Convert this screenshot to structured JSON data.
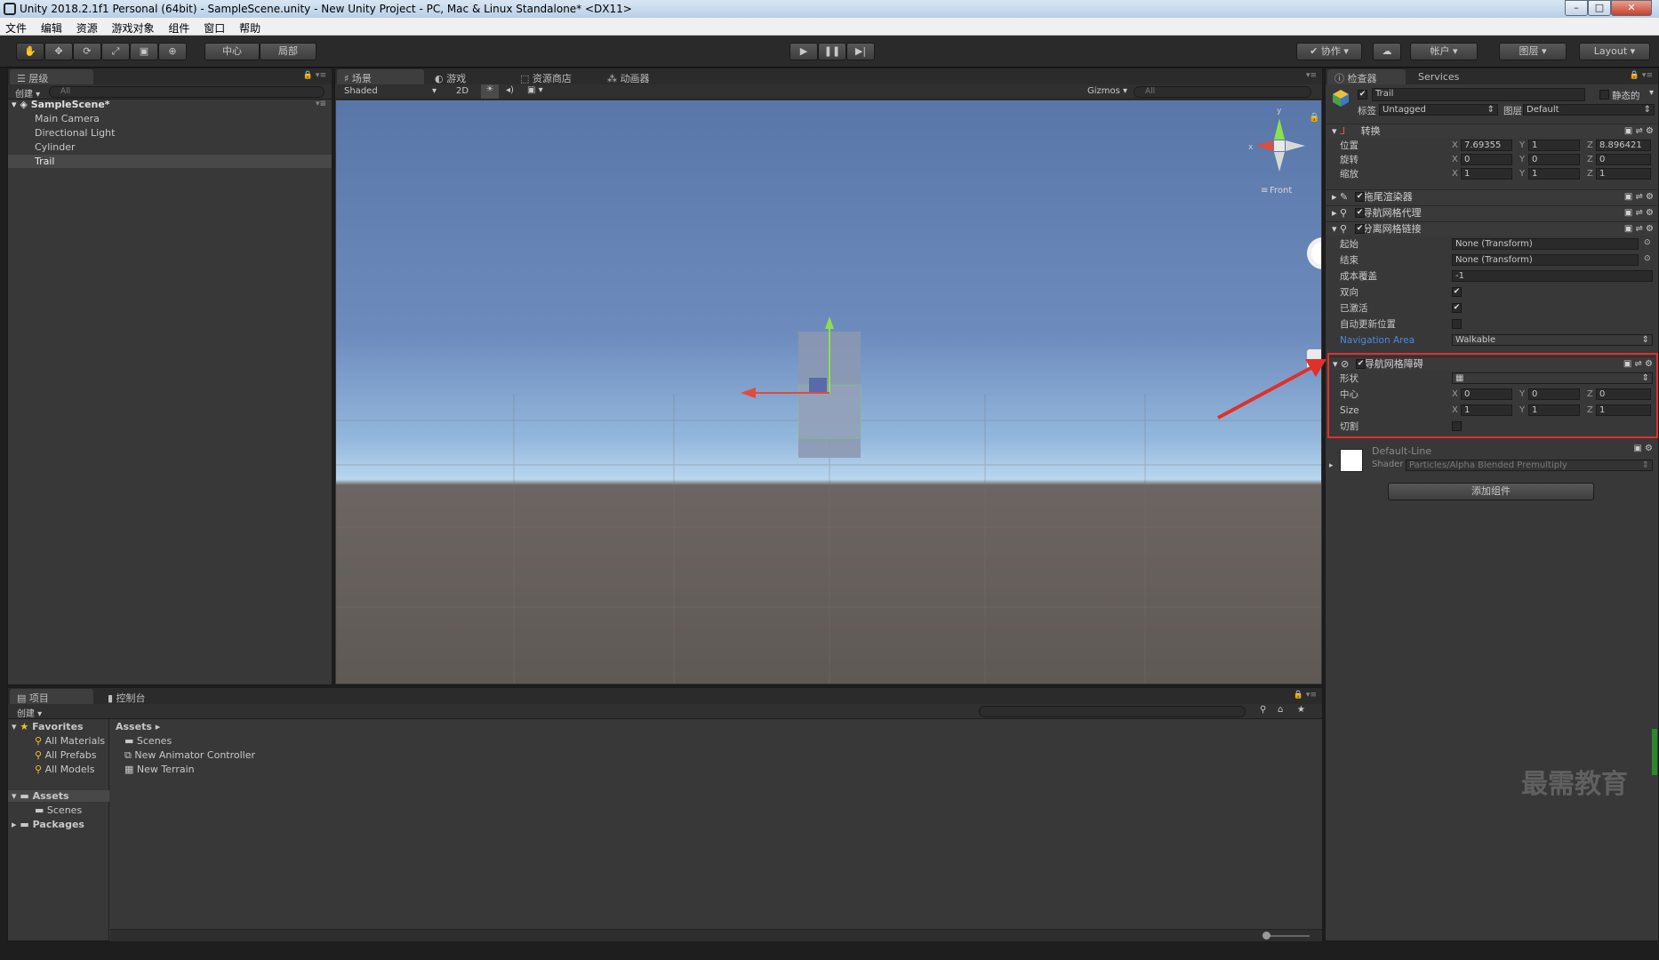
{
  "window": {
    "title": "Unity 2018.2.1f1 Personal (64bit) - SampleScene.unity - New Unity Project - PC, Mac & Linux Standalone* <DX11>"
  },
  "menu": [
    "文件",
    "编辑",
    "资源",
    "游戏对象",
    "组件",
    "窗口",
    "帮助"
  ],
  "toolbar": {
    "pivot": "中心",
    "space": "局部",
    "collab": "协作",
    "account": "帐户",
    "layers": "图层",
    "layout": "Layout"
  },
  "hierarchy": {
    "tab": "层级",
    "create": "创建",
    "search_placeholder": "All",
    "scene": "SampleScene*",
    "items": [
      "Main Camera",
      "Directional Light",
      "Cylinder",
      "Trail"
    ]
  },
  "scene_tabs": {
    "scene": "场景",
    "game": "游戏",
    "asset_store": "资源商店",
    "animator": "动画器",
    "shading": "Shaded",
    "mode_2d": "2D",
    "gizmos": "Gizmos",
    "search_placeholder": "All",
    "view_label": "Front",
    "axis_x": "x",
    "axis_y": "y"
  },
  "inspector": {
    "tab": "检查器",
    "services_tab": "Services",
    "object_name": "Trail",
    "static_label": "静态的",
    "tag_label": "标签",
    "tag_value": "Untagged",
    "layer_label": "图层",
    "layer_value": "Default",
    "transform": {
      "title": "转换",
      "position_label": "位置",
      "rotation_label": "旋转",
      "scale_label": "缩放",
      "position": {
        "x": "7.69355",
        "y": "1",
        "z": "8.896421"
      },
      "rotation": {
        "x": "0",
        "y": "0",
        "z": "0"
      },
      "scale": {
        "x": "1",
        "y": "1",
        "z": "1"
      }
    },
    "trail_renderer": "拖尾渲染器",
    "nav_agent": "导航网格代理",
    "offmesh_link": {
      "title": "分离网格链接",
      "start_label": "起始",
      "start_value": "None (Transform)",
      "end_label": "结束",
      "end_value": "None (Transform)",
      "cost_label": "成本覆盖",
      "cost_value": "-1",
      "bidirectional_label": "双向",
      "activated_label": "已激活",
      "auto_update_label": "自动更新位置",
      "nav_area_label": "Navigation Area",
      "nav_area_value": "Walkable"
    },
    "obstacle": {
      "title": "导航网格障碍",
      "shape_label": "形状",
      "center_label": "中心",
      "size_label": "Size",
      "carve_label": "切割",
      "center": {
        "x": "0",
        "y": "0",
        "z": "0"
      },
      "size": {
        "x": "1",
        "y": "1",
        "z": "1"
      }
    },
    "material": {
      "name": "Default-Line",
      "shader_label": "Shader",
      "shader_value": "Particles/Alpha Blended Premultiply"
    },
    "add_component": "添加组件",
    "axis": {
      "x": "X",
      "y": "Y",
      "z": "Z"
    }
  },
  "project": {
    "tab": "项目",
    "console_tab": "控制台",
    "create": "创建",
    "favorites": "Favorites",
    "favorites_items": [
      "All Materials",
      "All Prefabs",
      "All Models"
    ],
    "assets_root": "Assets",
    "assets_children": [
      "Scenes"
    ],
    "packages": "Packages",
    "breadcrumb": "Assets",
    "assets_items": [
      "Scenes",
      "New Animator Controller",
      "New Terrain"
    ]
  },
  "watermark": "最需教育",
  "colors": {
    "highlight_box": "#e0302a",
    "arrow": "#e0302a",
    "nav_area_blue": "#4a8be0"
  }
}
